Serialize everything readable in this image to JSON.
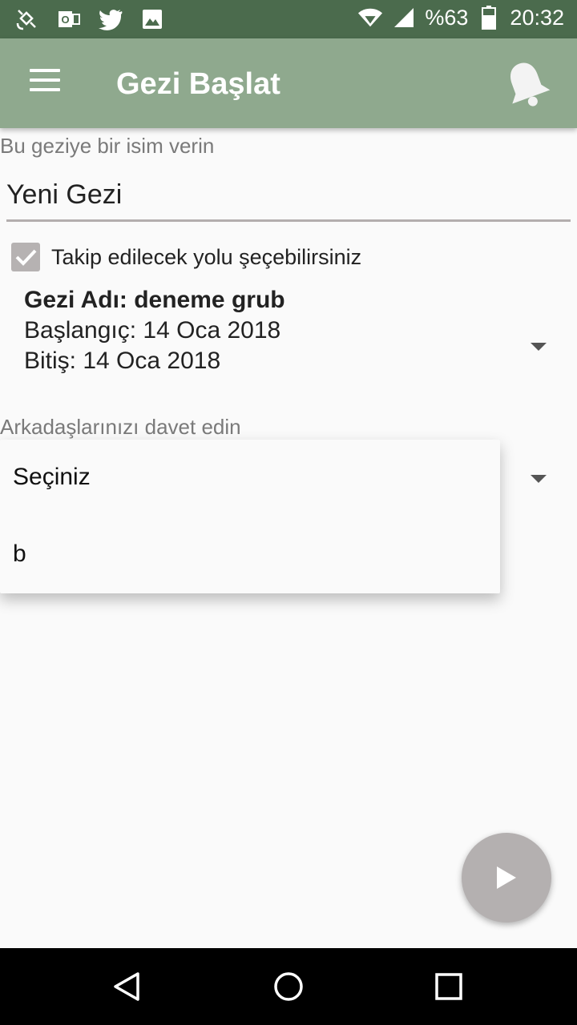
{
  "status_bar": {
    "battery": "%63",
    "time": "20:32",
    "icons": [
      "satellite-icon",
      "outlook-icon",
      "twitter-icon",
      "image-icon",
      "wifi-icon",
      "signal-icon",
      "battery-icon"
    ]
  },
  "app_bar": {
    "title": "Gezi Başlat",
    "menu_icon": "hamburger-menu-icon",
    "notification_icon": "bell-icon"
  },
  "trip_name": {
    "label": "Bu geziye bir isim verin",
    "value": "Yeni Gezi"
  },
  "route": {
    "checkbox_label": "Takip edilecek yolu şeçebilirsiniz",
    "checked": true,
    "selected": {
      "name": "Gezi Adı: deneme grub",
      "start": "Başlangıç: 14 Oca 2018",
      "end": "Bitiş: 14 Oca 2018"
    }
  },
  "friends": {
    "label": "Arkadaşlarınızı davet edin",
    "options": [
      "Seçiniz",
      "b"
    ]
  },
  "fab": {
    "icon": "play-icon"
  },
  "nav_bar": {
    "icons": [
      "back-icon",
      "home-icon",
      "recents-icon"
    ]
  },
  "colors": {
    "status_bar": "#4b6b4d",
    "app_bar": "#8fa98e",
    "background": "#fafafa",
    "fab": "#b4b0b0",
    "input_underline": "#b3aeae"
  }
}
